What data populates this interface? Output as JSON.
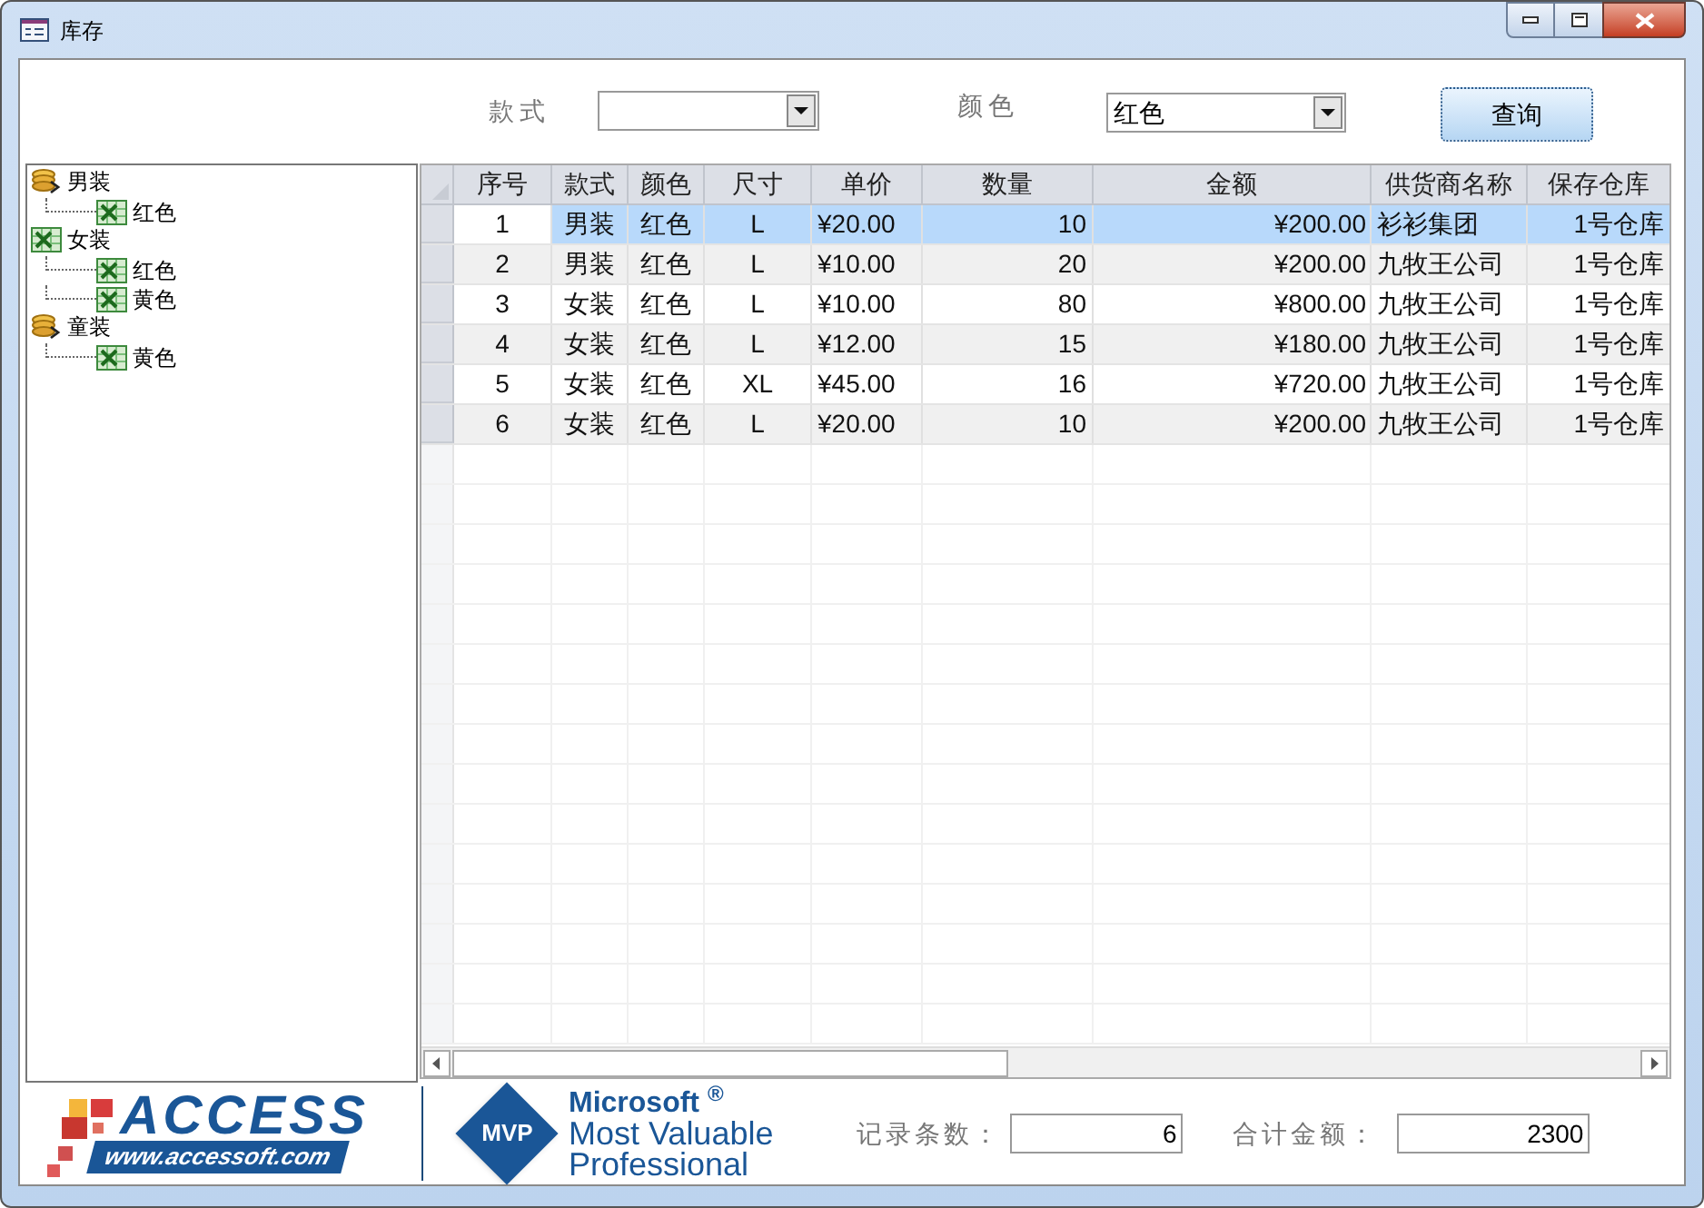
{
  "window": {
    "title": "库存"
  },
  "filters": [
    {
      "label": "款式"
    },
    {
      "label": "颜色",
      "value": "红色"
    }
  ],
  "query_button": "查询",
  "tree": [
    {
      "label": "男装",
      "kind": "stack",
      "children": [
        {
          "label": "红色",
          "kind": "sheet"
        }
      ]
    },
    {
      "label": "女装",
      "kind": "sheet",
      "children": [
        {
          "label": "红色",
          "kind": "sheet"
        },
        {
          "label": "黄色",
          "kind": "sheet"
        }
      ]
    },
    {
      "label": "童装",
      "kind": "stack",
      "children": [
        {
          "label": "黄色",
          "kind": "sheet"
        }
      ]
    }
  ],
  "table": {
    "columns": [
      "序号",
      "款式",
      "颜色",
      "尺寸",
      "单价",
      "数量",
      "金额",
      "供货商名称",
      "保存仓库"
    ],
    "rows": [
      {
        "selected": true,
        "cells": [
          "1",
          "男装",
          "红色",
          "L",
          "¥20.00",
          "10",
          "¥200.00",
          "衫衫集团",
          "1号仓库"
        ]
      },
      {
        "selected": false,
        "cells": [
          "2",
          "男装",
          "红色",
          "L",
          "¥10.00",
          "20",
          "¥200.00",
          "九牧王公司",
          "1号仓库"
        ]
      },
      {
        "selected": false,
        "cells": [
          "3",
          "女装",
          "红色",
          "L",
          "¥10.00",
          "80",
          "¥800.00",
          "九牧王公司",
          "1号仓库"
        ]
      },
      {
        "selected": false,
        "cells": [
          "4",
          "女装",
          "红色",
          "L",
          "¥12.00",
          "15",
          "¥180.00",
          "九牧王公司",
          "1号仓库"
        ]
      },
      {
        "selected": false,
        "cells": [
          "5",
          "女装",
          "红色",
          "XL",
          "¥45.00",
          "16",
          "¥720.00",
          "九牧王公司",
          "1号仓库"
        ]
      },
      {
        "selected": false,
        "cells": [
          "6",
          "女装",
          "红色",
          "L",
          "¥20.00",
          "10",
          "¥200.00",
          "九牧王公司",
          "1号仓库"
        ]
      }
    ]
  },
  "footer": {
    "access_logo": {
      "name": "ACCESS",
      "url": "www.accessoft.com"
    },
    "mvp_logo": {
      "badge": "MVP",
      "brand": "Microsoft",
      "mark": "®",
      "line_1": "Most Valuable",
      "line_2": "Professional"
    },
    "fields": [
      {
        "label": "记录条数：",
        "value": "6"
      },
      {
        "label": "合计金额：",
        "value": "2300"
      }
    ]
  }
}
